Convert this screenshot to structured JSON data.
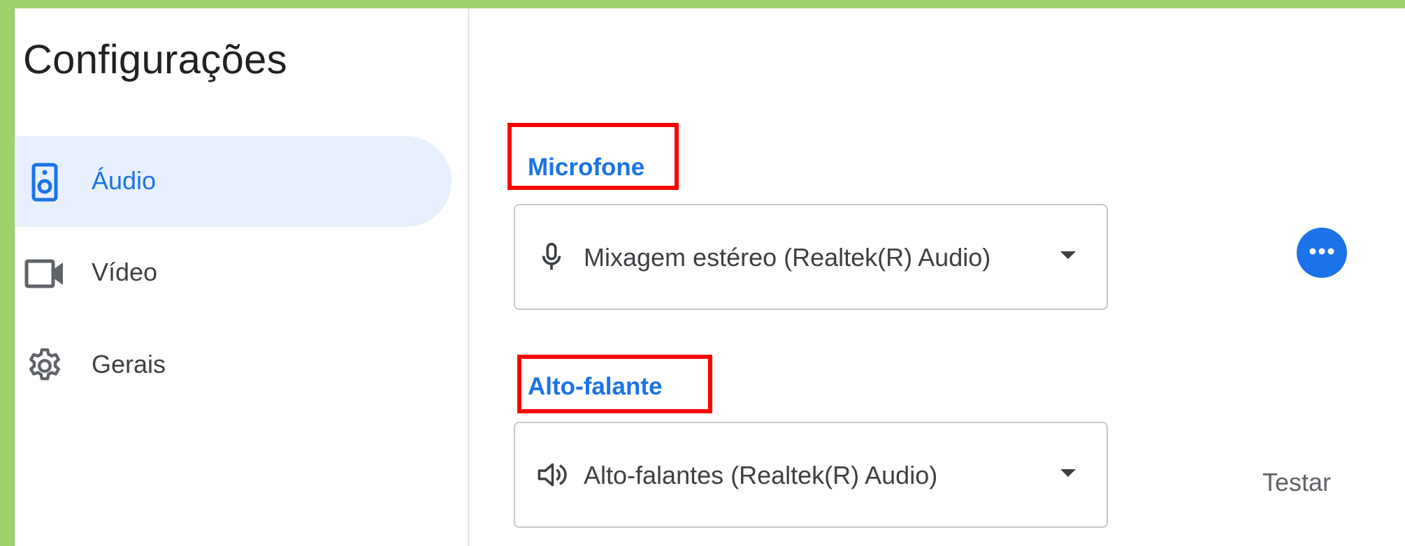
{
  "sidebar": {
    "title": "Configurações",
    "items": [
      {
        "label": "Áudio",
        "icon": "speaker-icon",
        "active": true
      },
      {
        "label": "Vídeo",
        "icon": "video-camera-icon",
        "active": false
      },
      {
        "label": "Gerais",
        "icon": "gear-icon",
        "active": false
      }
    ]
  },
  "main": {
    "microphone": {
      "label": "Microfone",
      "selected": "Mixagem estéreo (Realtek(R) Audio)",
      "icon": "microphone-icon",
      "more_icon": "more-horizontal-icon"
    },
    "speaker": {
      "label": "Alto-falante",
      "selected": "Alto-falantes (Realtek(R) Audio)",
      "icon": "speaker-volume-icon",
      "test_label": "Testar"
    }
  },
  "colors": {
    "accent": "#1a73e8",
    "active_bg": "#e8f0fe",
    "highlight": "#ff0000",
    "frame": "#9fd16a"
  }
}
